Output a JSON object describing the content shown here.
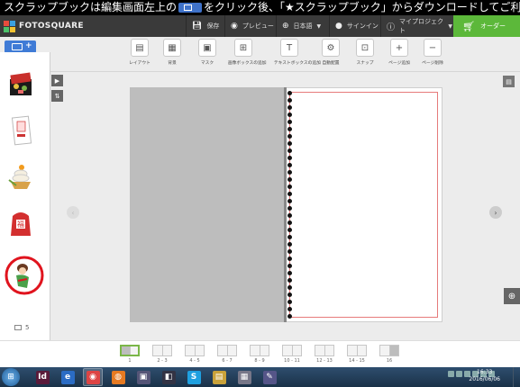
{
  "banner": {
    "text_before": "スクラップブックは編集画面左上の",
    "text_after": "をクリック後、「★スクラップブック」からダウンロードしてご利用ください。"
  },
  "topnav": {
    "logo": "FOTOSQUARE",
    "save": "保存",
    "preview": "プレビュー",
    "language": "日本語",
    "signin": "サインイン",
    "myproject": "マイプロジェクト",
    "order": "オーダー"
  },
  "toolbar": {
    "add_image": "+",
    "tools": [
      {
        "label": "レイアウト",
        "icon": "layout-icon",
        "glyph": "▤"
      },
      {
        "label": "背景",
        "icon": "background-icon",
        "glyph": "▦"
      },
      {
        "label": "マスク",
        "icon": "mask-icon",
        "glyph": "▣"
      },
      {
        "label": "画像ボックスの追加",
        "icon": "add-image-box-icon",
        "glyph": "⊞"
      },
      {
        "label": "テキストボックスの追加",
        "icon": "add-text-box-icon",
        "glyph": "T"
      },
      {
        "label": "自動配置",
        "icon": "auto-arrange-icon",
        "glyph": "⚙"
      },
      {
        "label": "スナップ",
        "icon": "snap-icon",
        "glyph": "⊡"
      },
      {
        "label": "ページ追加",
        "icon": "add-page-icon",
        "glyph": "+"
      },
      {
        "label": "ページ削除",
        "icon": "delete-page-icon",
        "glyph": "−"
      }
    ]
  },
  "left_panel": {
    "image_count": "5"
  },
  "pages": [
    {
      "label": "1",
      "active": true
    },
    {
      "label": "2 - 3"
    },
    {
      "label": "4 - 5"
    },
    {
      "label": "6 - 7"
    },
    {
      "label": "8 - 9"
    },
    {
      "label": "10 - 11"
    },
    {
      "label": "12 - 13"
    },
    {
      "label": "14 - 15"
    },
    {
      "label": "16"
    }
  ],
  "taskbar": {
    "time": "16:33",
    "date": "2016/06/06",
    "apps": [
      {
        "name": "indesign",
        "glyph": "Id",
        "color": "#5a1a3a"
      },
      {
        "name": "internet-explorer",
        "glyph": "e",
        "color": "#2b6cc4"
      },
      {
        "name": "chrome",
        "glyph": "◉",
        "color": "#d44"
      },
      {
        "name": "firefox",
        "glyph": "◍",
        "color": "#e67a22"
      },
      {
        "name": "app-window",
        "glyph": "▣",
        "color": "#557"
      },
      {
        "name": "photoshop-elements",
        "glyph": "◧",
        "color": "#334"
      },
      {
        "name": "skype",
        "glyph": "S",
        "color": "#1fa0e0"
      },
      {
        "name": "file-explorer",
        "glyph": "▤",
        "color": "#c9a23a"
      },
      {
        "name": "calculator",
        "glyph": "▦",
        "color": "#778"
      },
      {
        "name": "notes-app",
        "glyph": "✎",
        "color": "#558"
      }
    ]
  },
  "colors": {
    "accent_blue": "#3f7bd6",
    "order_green": "#5cb83a",
    "page_border_red": "#e67b7b",
    "selection_circle": "#e0141e"
  }
}
